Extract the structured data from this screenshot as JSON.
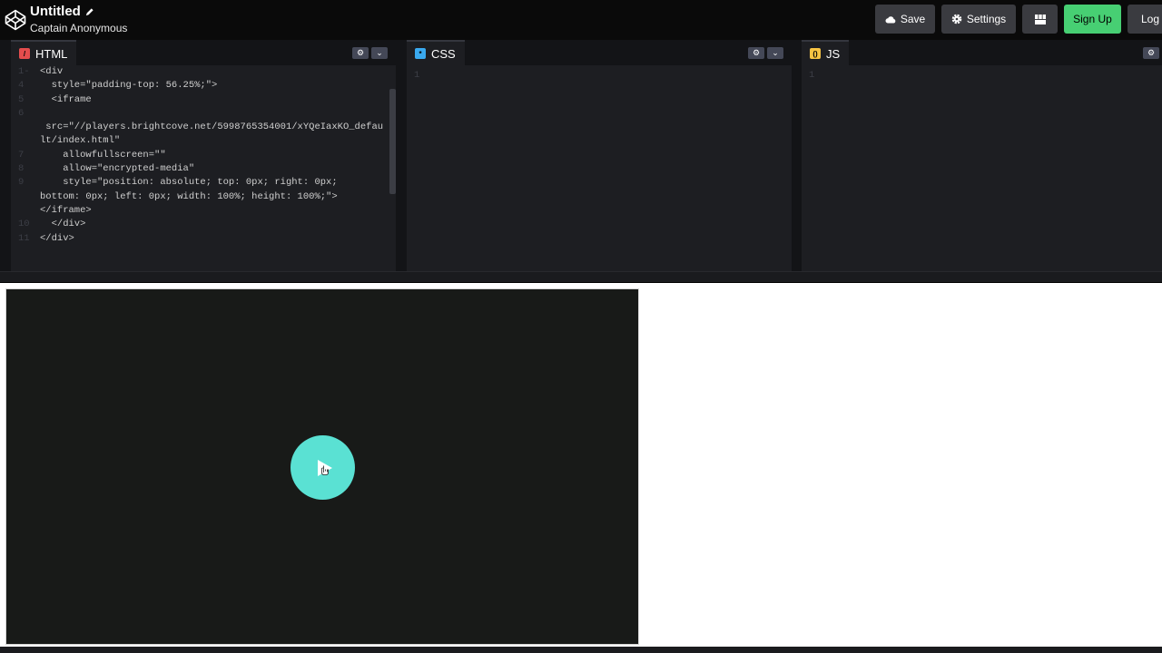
{
  "header": {
    "title": "Untitled",
    "user": "Captain Anonymous",
    "buttons": {
      "save": "Save",
      "settings": "Settings",
      "signup": "Sign Up",
      "login": "Log I"
    }
  },
  "editors": {
    "html": {
      "label": "HTML",
      "icon_color": "#e44d4d",
      "lines": [
        {
          "num": "1-",
          "text": "<div"
        },
        {
          "num": "4",
          "text": "  style=\"padding-top: 56.25%;\">"
        },
        {
          "num": "5",
          "text": "  <iframe"
        },
        {
          "num": "6",
          "text": ""
        },
        {
          "num": "",
          "text": " src=\"//players.brightcove.net/5998765354001/xYQeIaxKO_defau"
        },
        {
          "num": "",
          "text": "lt/index.html\""
        },
        {
          "num": "7",
          "text": "    allowfullscreen=\"\""
        },
        {
          "num": "8",
          "text": "    allow=\"encrypted-media\""
        },
        {
          "num": "9",
          "text": "    style=\"position: absolute; top: 0px; right: 0px;"
        },
        {
          "num": "",
          "text": "bottom: 0px; left: 0px; width: 100%; height: 100%;\">"
        },
        {
          "num": "",
          "text": "</iframe>"
        },
        {
          "num": "10",
          "text": "  </div>"
        },
        {
          "num": "11",
          "text": "</div>"
        }
      ]
    },
    "css": {
      "label": "CSS",
      "icon_color": "#3aa9ef",
      "lines": [
        {
          "num": "1",
          "text": ""
        }
      ]
    },
    "js": {
      "label": "JS",
      "icon_color": "#f6c343",
      "lines": [
        {
          "num": "1",
          "text": ""
        }
      ]
    }
  },
  "result": {
    "play_color": "#5ae1d3"
  },
  "colors": {
    "signup": "#47cf73",
    "button": "#3a3b40"
  }
}
